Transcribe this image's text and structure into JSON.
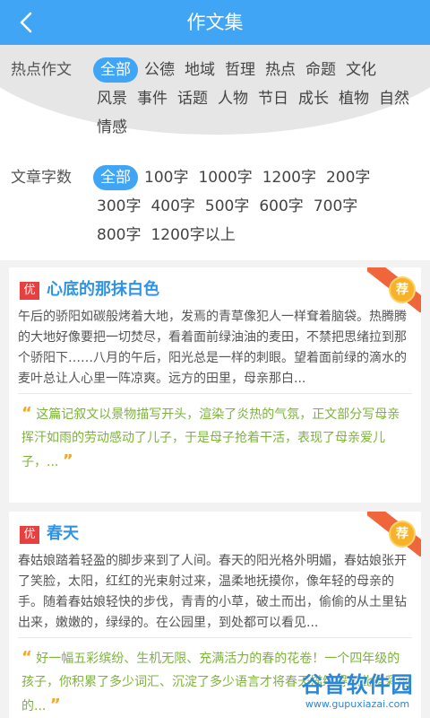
{
  "header": {
    "title": "作文集"
  },
  "filters": [
    {
      "label": "热点作文",
      "options": [
        "全部",
        "公德",
        "地域",
        "哲理",
        "热点",
        "命题",
        "文化",
        "风景",
        "事件",
        "话题",
        "人物",
        "节日",
        "成长",
        "植物",
        "自然",
        "情感"
      ],
      "active": 0
    },
    {
      "label": "文章字数",
      "options": [
        "全部",
        "100字",
        "1000字",
        "1200字",
        "200字",
        "300字",
        "400字",
        "500字",
        "600字",
        "700字",
        "800字",
        "1200字以上"
      ],
      "active": 0
    }
  ],
  "articles": [
    {
      "tag": "优",
      "badge": "荐",
      "title": "心底的那抹白色",
      "excerpt": "午后的骄阳如碳般烤着大地，发焉的青草像犯人一样耷着脑袋。热腾腾的大地好像要把一切焚尽，看着面前绿油油的麦田，不禁把思绪拉到那个骄阳下……八月的午后，阳光总是一样的刺眼。望着面前绿的滴水的麦叶总让人心里一阵凉爽。远方的田里，母亲那白...",
      "comment": "这篇记叙文以景物描写开头，渲染了炎热的气氛，正文部分写母亲挥汗如雨的劳动感动了儿子，于是母子抢着干活，表现了母亲爱儿子，..."
    },
    {
      "tag": "优",
      "badge": "荐",
      "title": "春天",
      "excerpt": "春姑娘踏着轻盈的脚步来到了人间。春天的阳光格外明媚，春姑娘张开了笑脸，太阳，红红的光束射过来，温柔地抚摸你，像年轻的母亲的手。随着春姑娘轻快的步伐，青青的小草，破土而出，偷偷的从土里钻出来，嫩嫩的，绿绿的。在公园里，到处都可以看见...",
      "comment": "好一幅五彩缤纷、生机无限、充满活力的春的花卷！一个四年级的孩子，你积累了多少词汇、沉淀了多少语言才将春天描绘得如此精彩绝的..."
    }
  ],
  "watermark": {
    "name": "谷普软件园",
    "url": "www.gupuxiazai.com"
  },
  "colors": {
    "primary": "#41a5f5",
    "tag": "#e74040",
    "comment": "#7cb33a",
    "badge": "#f7b22a",
    "ribbon": "#f0653a"
  }
}
